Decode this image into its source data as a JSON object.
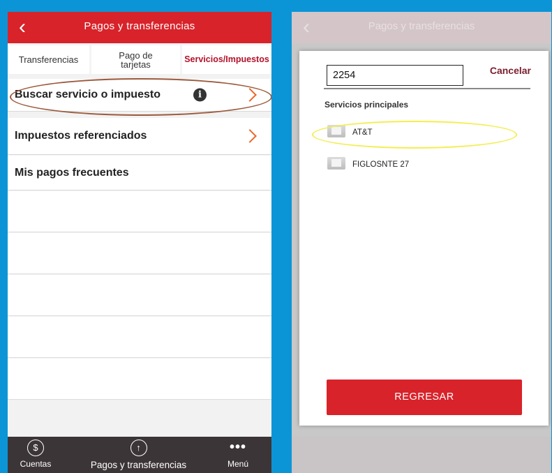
{
  "left": {
    "header": {
      "back_glyph": "‹",
      "title": "Pagos y transferencias"
    },
    "tabs": [
      {
        "label": "Transferencias"
      },
      {
        "label": "Pago de tarjetas",
        "line1": "Pago de",
        "line2": "tarjetas"
      },
      {
        "label": "Servicios/Impuestos",
        "active": true
      }
    ],
    "rows": [
      {
        "label": "Buscar servicio o impuesto",
        "has_info": true,
        "has_chevron": true,
        "info_glyph": "i"
      },
      {
        "label": "Impuestos referenciados",
        "has_chevron": true
      },
      {
        "label": "Mis pagos frecuentes",
        "has_chevron": false
      }
    ],
    "bottom_nav": [
      {
        "label": "Cuentas",
        "icon": "dollar-icon",
        "glyph": "$"
      },
      {
        "label": "Pagos y transferencias",
        "icon": "arrow-up-icon",
        "glyph": "↑"
      },
      {
        "label": "Menú",
        "icon": "more-dots-icon",
        "glyph": "•••"
      }
    ],
    "colors": {
      "header_red": "#d8232a",
      "accent_orange": "#e8682a",
      "active_tab": "#b3122a",
      "nav_bg": "#3c3537"
    }
  },
  "right": {
    "header": {
      "back_glyph": "‹",
      "title": "Pagos y transferencias"
    },
    "modal": {
      "search_value": "2254",
      "cancel_label": "Cancelar",
      "section_title": "Servicios principales",
      "services": [
        {
          "name": "AT&T",
          "highlighted": true
        },
        {
          "name": "FIGLOSNTE 27"
        }
      ],
      "button_label": "REGRESAR"
    },
    "colors": {
      "button_red": "#d8232a",
      "cancel": "#7a1e2e",
      "highlight_yellow": "#f3ee4d"
    }
  }
}
